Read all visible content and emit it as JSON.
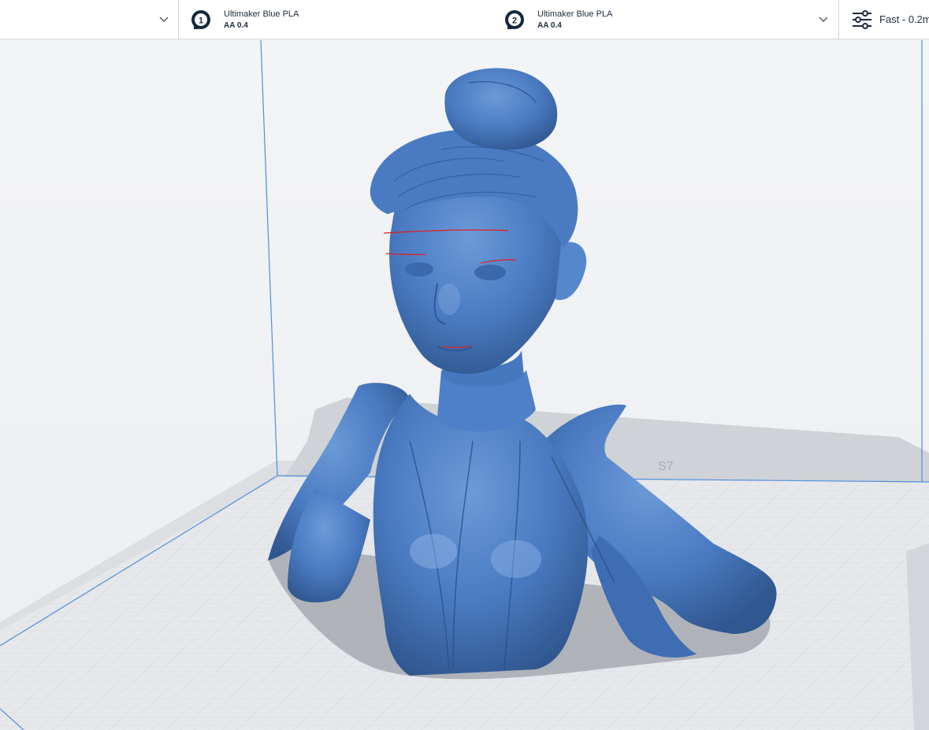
{
  "header": {
    "extruders": [
      {
        "number": "1",
        "material": "Ultimaker Blue PLA",
        "core": "AA 0.4"
      },
      {
        "number": "2",
        "material": "Ultimaker Blue PLA",
        "core": "AA 0.4"
      }
    ],
    "print_profile": {
      "label": "Fast - 0.2m",
      "icon": "sliders-icon"
    }
  },
  "viewport": {
    "model_color": "#4a7bc2",
    "overhang_color": "#e02020",
    "build_volume_line_color": "#4f8fdc",
    "build_plate_logo": "S7"
  },
  "colors": {
    "header_bg": "#ffffff",
    "text_primary": "#1f2b3d",
    "badge_dark": "#14283f"
  }
}
